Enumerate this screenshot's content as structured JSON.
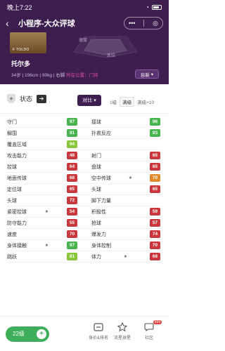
{
  "statusbar": {
    "time": "晚上7:22",
    "icons": "✉ ▾ ▮▮"
  },
  "nav": {
    "title": "小程序-大众评球",
    "more": "•••"
  },
  "player": {
    "card_label": "F TOLDO",
    "name": "托尔多",
    "info": "34岁 | 196cm | 90kg | 右脚",
    "link": "所在位置：门将",
    "radar_labels": [
      "速度",
      "反应"
    ],
    "follow_label": "自新"
  },
  "toolbar": {
    "state_label": "状态",
    "compare_label": "对比",
    "level_label": "1级",
    "level_chip": "满级",
    "max_label": "满级+10"
  },
  "colors": {
    "green": "#47b44d",
    "lime": "#8ac63a",
    "yellow_green": "#a6cc2e",
    "orange": "#e08a2a",
    "red": "#c9373c",
    "dark_red": "#b22b35"
  },
  "attributes": [
    {
      "left": {
        "name": "守门",
        "value": "97",
        "color": "#47b44d"
      },
      "right": {
        "name": "接球",
        "value": "96",
        "color": "#47b44d"
      }
    },
    {
      "left": {
        "name": "解围",
        "value": "91",
        "color": "#47b44d"
      },
      "right": {
        "name": "扑救反应",
        "value": "93",
        "color": "#47b44d"
      }
    },
    {
      "left": {
        "name": "覆盖区域",
        "value": "94",
        "color": "#8ac63a"
      },
      "right": {
        "name": "",
        "value": "",
        "color": ""
      }
    },
    {
      "left": {
        "name": "攻击能力",
        "value": "48",
        "color": "#c9373c"
      },
      "right": {
        "name": "射门",
        "value": "65",
        "color": "#c9373c"
      }
    },
    {
      "left": {
        "name": "控球",
        "value": "64",
        "color": "#c9373c"
      },
      "right": {
        "name": "盘球",
        "value": "65",
        "color": "#c9373c"
      }
    },
    {
      "left": {
        "name": "地面传球",
        "value": "68",
        "color": "#c9373c"
      },
      "right": {
        "name": "空中传球",
        "value": "70",
        "color": "#e08a2a",
        "star": true
      }
    },
    {
      "left": {
        "name": "定位球",
        "value": "65",
        "color": "#c9373c"
      },
      "right": {
        "name": "头球",
        "value": "65",
        "color": "#c9373c"
      }
    },
    {
      "left": {
        "name": "头球",
        "value": "72",
        "color": "#c9373c"
      },
      "right": {
        "name": "脚下力量",
        "value": "",
        "color": ""
      }
    },
    {
      "left": {
        "name": "紧密控球",
        "value": "54",
        "color": "#c9373c",
        "star": true
      },
      "right": {
        "name": "积极性",
        "value": "59",
        "color": "#c9373c"
      }
    },
    {
      "left": {
        "name": "防守能力",
        "value": "55",
        "color": "#c9373c"
      },
      "right": {
        "name": "抢球",
        "value": "57",
        "color": "#c9373c"
      }
    },
    {
      "left": {
        "name": "速度",
        "value": "70",
        "color": "#c9373c"
      },
      "right": {
        "name": "爆发力",
        "value": "74",
        "color": "#c9373c"
      }
    },
    {
      "left": {
        "name": "身体接触",
        "value": "97",
        "color": "#47b44d",
        "star": true
      },
      "right": {
        "name": "身体控制",
        "value": "70",
        "color": "#c9373c"
      }
    },
    {
      "left": {
        "name": "跳跃",
        "value": "81",
        "color": "#8ac63a"
      },
      "right": {
        "name": "体力",
        "value": "68",
        "color": "#c9373c",
        "star": true
      }
    }
  ],
  "bottombar": {
    "add_label": "22级",
    "tabs": [
      {
        "label": "身价&排名",
        "icon": "compare-icon"
      },
      {
        "label": "流星球星",
        "icon": "star-icon"
      },
      {
        "label": "社区",
        "icon": "chat-icon",
        "badge": "999"
      }
    ]
  }
}
